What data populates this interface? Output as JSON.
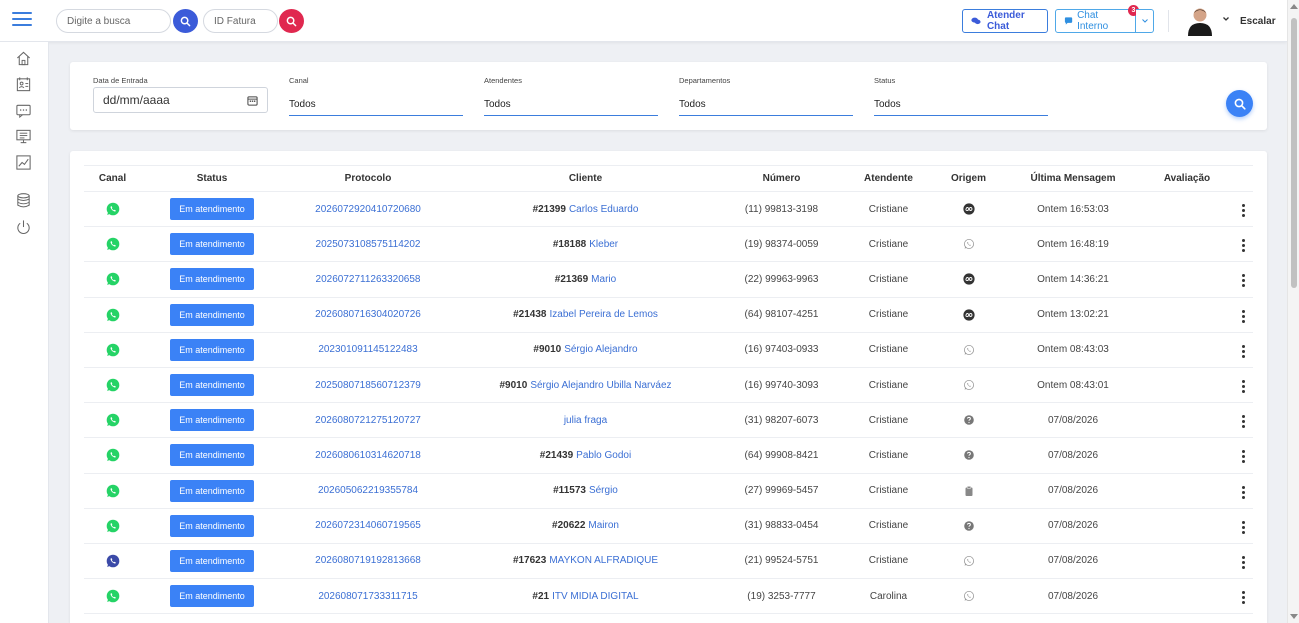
{
  "header": {
    "search_placeholder": "Digite a busca",
    "invoice_placeholder": "ID Fatura",
    "attend_chat_label": "Atender Chat",
    "internal_chat_label": "Chat Interno",
    "internal_chat_badge": "3",
    "user_name": "Escalar"
  },
  "filters": {
    "date_label": "Data de Entrada",
    "date_value": "dd/mm/aaaa",
    "channel_label": "Canal",
    "channel_value": "Todos",
    "agents_label": "Atendentes",
    "agents_value": "Todos",
    "departments_label": "Departamentos",
    "departments_value": "Todos",
    "status_label": "Status",
    "status_value": "Todos"
  },
  "table": {
    "columns": [
      "Canal",
      "Status",
      "Protocolo",
      "Cliente",
      "Número",
      "Atendente",
      "Origem",
      "Última Mensagem",
      "Avaliação"
    ],
    "rows": [
      {
        "channel": "whatsapp",
        "status": "Em atendimento",
        "protocol": "2026072920410720680",
        "client_id": "#21399",
        "client_name": "Carlos Eduardo",
        "number": "(11) 99813-3198",
        "agent": "Cristiane",
        "origin": "meta",
        "last": "Ontem 16:53:03"
      },
      {
        "channel": "whatsapp",
        "status": "Em atendimento",
        "protocol": "2025073108575114202",
        "client_id": "#18188",
        "client_name": "Kleber",
        "number": "(19) 98374-0059",
        "agent": "Cristiane",
        "origin": "whatsapp",
        "last": "Ontem 16:48:19"
      },
      {
        "channel": "whatsapp",
        "status": "Em atendimento",
        "protocol": "2026072711263320658",
        "client_id": "#21369",
        "client_name": "Mario",
        "number": "(22) 99963-9963",
        "agent": "Cristiane",
        "origin": "meta",
        "last": "Ontem 14:36:21"
      },
      {
        "channel": "whatsapp",
        "status": "Em atendimento",
        "protocol": "2026080716304020726",
        "client_id": "#21438",
        "client_name": "Izabel Pereira de Lemos",
        "number": "(64) 98107-4251",
        "agent": "Cristiane",
        "origin": "meta",
        "last": "Ontem 13:02:21"
      },
      {
        "channel": "whatsapp",
        "status": "Em atendimento",
        "protocol": "202301091145122483",
        "client_id": "#9010",
        "client_name": "Sérgio Alejandro",
        "number": "(16) 97403-0933",
        "agent": "Cristiane",
        "origin": "whatsapp",
        "last": "Ontem 08:43:03"
      },
      {
        "channel": "whatsapp",
        "status": "Em atendimento",
        "protocol": "2025080718560712379",
        "client_id": "#9010",
        "client_name": "Sérgio Alejandro Ubilla Narváez",
        "number": "(16) 99740-3093",
        "agent": "Cristiane",
        "origin": "whatsapp",
        "last": "Ontem 08:43:01"
      },
      {
        "channel": "whatsapp",
        "status": "Em atendimento",
        "protocol": "2026080721275120727",
        "client_id": "",
        "client_name": "julia fraga",
        "number": "(31) 98207-6073",
        "agent": "Cristiane",
        "origin": "question",
        "last": "07/08/2026"
      },
      {
        "channel": "whatsapp",
        "status": "Em atendimento",
        "protocol": "2026080610314620718",
        "client_id": "#21439",
        "client_name": "Pablo Godoi",
        "number": "(64) 99908-8421",
        "agent": "Cristiane",
        "origin": "question",
        "last": "07/08/2026"
      },
      {
        "channel": "whatsapp",
        "status": "Em atendimento",
        "protocol": "202605062219355784",
        "client_id": "#11573",
        "client_name": "Sérgio",
        "number": "(27) 99969-5457",
        "agent": "Cristiane",
        "origin": "clipboard",
        "last": "07/08/2026"
      },
      {
        "channel": "whatsapp",
        "status": "Em atendimento",
        "protocol": "2026072314060719565",
        "client_id": "#20622",
        "client_name": "Mairon",
        "number": "(31) 98833-0454",
        "agent": "Cristiane",
        "origin": "question",
        "last": "07/08/2026"
      },
      {
        "channel": "phone",
        "status": "Em atendimento",
        "protocol": "2026080719192813668",
        "client_id": "#17623",
        "client_name": "MAYKON ALFRADIQUE",
        "number": "(21) 99524-5751",
        "agent": "Cristiane",
        "origin": "whatsapp",
        "last": "07/08/2026"
      },
      {
        "channel": "whatsapp",
        "status": "Em atendimento",
        "protocol": "202608071733311715",
        "client_id": "#21",
        "client_name": "ITV MIDIA DIGITAL",
        "number": "(19) 3253-7777",
        "agent": "Carolina",
        "origin": "whatsapp",
        "last": "07/08/2026"
      }
    ]
  },
  "colors": {
    "primary": "#3b82f6",
    "whatsapp": "#25d366",
    "danger": "#e0284f",
    "link": "#3b6fd4"
  }
}
